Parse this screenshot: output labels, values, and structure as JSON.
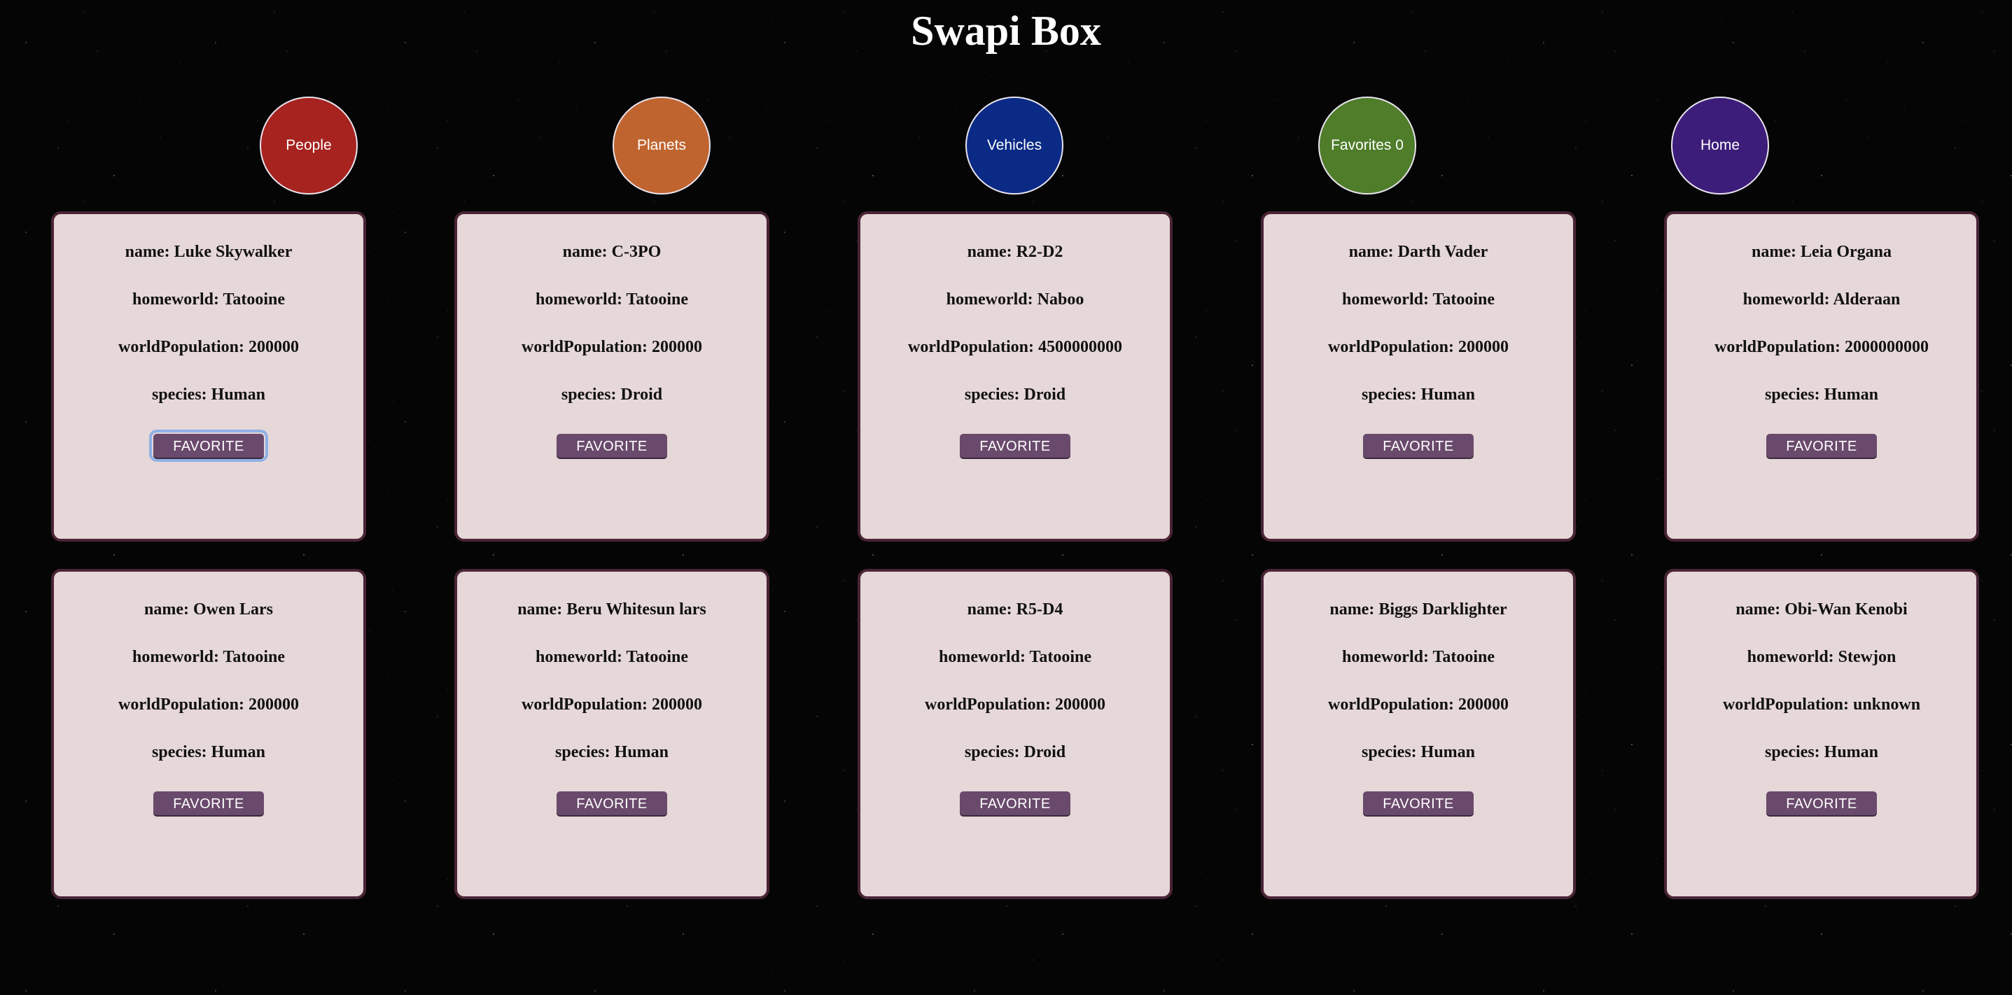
{
  "app": {
    "title": "Swapi Box"
  },
  "nav": [
    {
      "label": "People",
      "color": "#a6231f"
    },
    {
      "label": "Planets",
      "color": "#c0642f"
    },
    {
      "label": "Vehicles",
      "color": "#0a2a86"
    },
    {
      "label": "Favorites 0",
      "color": "#4f7d2a"
    },
    {
      "label": "Home",
      "color": "#3d1d7a"
    }
  ],
  "cards": [
    {
      "name": "name: Luke Skywalker",
      "homeworld": "homeworld: Tatooine",
      "population": "worldPopulation: 200000",
      "species": "species: Human",
      "button": "FAVORITE"
    },
    {
      "name": "name: C-3PO",
      "homeworld": "homeworld: Tatooine",
      "population": "worldPopulation: 200000",
      "species": "species: Droid",
      "button": "FAVORITE"
    },
    {
      "name": "name: R2-D2",
      "homeworld": "homeworld: Naboo",
      "population": "worldPopulation: 4500000000",
      "species": "species: Droid",
      "button": "FAVORITE"
    },
    {
      "name": "name: Darth Vader",
      "homeworld": "homeworld: Tatooine",
      "population": "worldPopulation: 200000",
      "species": "species: Human",
      "button": "FAVORITE"
    },
    {
      "name": "name: Leia Organa",
      "homeworld": "homeworld: Alderaan",
      "population": "worldPopulation: 2000000000",
      "species": "species: Human",
      "button": "FAVORITE"
    },
    {
      "name": "name: Owen Lars",
      "homeworld": "homeworld: Tatooine",
      "population": "worldPopulation: 200000",
      "species": "species: Human",
      "button": "FAVORITE"
    },
    {
      "name": "name: Beru Whitesun lars",
      "homeworld": "homeworld: Tatooine",
      "population": "worldPopulation: 200000",
      "species": "species: Human",
      "button": "FAVORITE"
    },
    {
      "name": "name: R5-D4",
      "homeworld": "homeworld: Tatooine",
      "population": "worldPopulation: 200000",
      "species": "species: Droid",
      "button": "FAVORITE"
    },
    {
      "name": "name: Biggs Darklighter",
      "homeworld": "homeworld: Tatooine",
      "population": "worldPopulation: 200000",
      "species": "species: Human",
      "button": "FAVORITE"
    },
    {
      "name": "name: Obi-Wan Kenobi",
      "homeworld": "homeworld: Stewjon",
      "population": "worldPopulation: unknown",
      "species": "species: Human",
      "button": "FAVORITE"
    }
  ]
}
